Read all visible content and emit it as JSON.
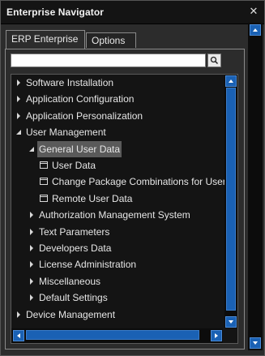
{
  "window": {
    "title": "Enterprise Navigator"
  },
  "tabs": [
    {
      "label": "ERP Enterprise",
      "active": true
    },
    {
      "label": "Options",
      "active": false
    }
  ],
  "search": {
    "value": "",
    "placeholder": ""
  },
  "tree": {
    "items": [
      {
        "label": "Software Installation",
        "level": 0,
        "type": "node",
        "expanded": false,
        "selected": false
      },
      {
        "label": "Application Configuration",
        "level": 0,
        "type": "node",
        "expanded": false,
        "selected": false
      },
      {
        "label": "Application Personalization",
        "level": 0,
        "type": "node",
        "expanded": false,
        "selected": false
      },
      {
        "label": "User Management",
        "level": 0,
        "type": "node",
        "expanded": true,
        "selected": false
      },
      {
        "label": "General User Data",
        "level": 1,
        "type": "node",
        "expanded": true,
        "selected": true
      },
      {
        "label": "User Data",
        "level": 2,
        "type": "leaf",
        "expanded": false,
        "selected": false
      },
      {
        "label": "Change Package Combinations for Users",
        "level": 2,
        "type": "leaf",
        "expanded": false,
        "selected": false
      },
      {
        "label": "Remote User Data",
        "level": 2,
        "type": "leaf",
        "expanded": false,
        "selected": false
      },
      {
        "label": "Authorization Management System",
        "level": 1,
        "type": "node",
        "expanded": false,
        "selected": false
      },
      {
        "label": "Text Parameters",
        "level": 1,
        "type": "node",
        "expanded": false,
        "selected": false
      },
      {
        "label": "Developers Data",
        "level": 1,
        "type": "node",
        "expanded": false,
        "selected": false
      },
      {
        "label": "License Administration",
        "level": 1,
        "type": "node",
        "expanded": false,
        "selected": false
      },
      {
        "label": "Miscellaneous",
        "level": 1,
        "type": "node",
        "expanded": false,
        "selected": false
      },
      {
        "label": "Default Settings",
        "level": 1,
        "type": "node",
        "expanded": false,
        "selected": false
      },
      {
        "label": "Device Management",
        "level": 0,
        "type": "node",
        "expanded": false,
        "selected": false
      }
    ]
  },
  "icons": {
    "close": "close-icon",
    "search": "search-icon",
    "collapsed": "triangle-right-icon",
    "expanded": "triangle-down-icon",
    "leaf": "document-icon",
    "scroll_up": "arrow-up-icon",
    "scroll_down": "arrow-down-icon",
    "scroll_left": "arrow-left-icon",
    "scroll_right": "arrow-right-icon"
  },
  "colors": {
    "background": "#2c2c2c",
    "titlebar": "#141414",
    "tree_background": "#141414",
    "accent": "#1a61b4",
    "selection": "#5a5a5a",
    "text": "#e6e6e6"
  }
}
